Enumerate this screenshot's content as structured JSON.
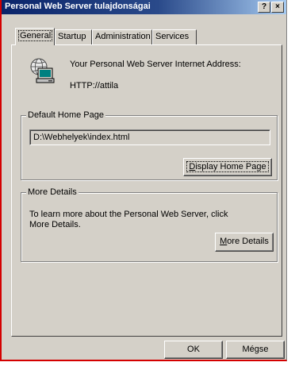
{
  "window": {
    "title": "Personal Web Server tulajdonságai",
    "help_glyph": "?",
    "close_glyph": "×"
  },
  "tabs": [
    {
      "label": "General",
      "active": true
    },
    {
      "label": "Startup",
      "active": false
    },
    {
      "label": "Administration",
      "active": false
    },
    {
      "label": "Services",
      "active": false
    }
  ],
  "general": {
    "server_icon": "pws-server-icon",
    "address_label": "Your Personal Web Server Internet Address:",
    "address_value": "HTTP://attila",
    "home_page_group": {
      "legend": "Default Home Page",
      "path": "D:\\Webhelyek\\index.html",
      "display_button": {
        "pre": "",
        "accel": "D",
        "post": "isplay Home Page"
      }
    },
    "more_details_group": {
      "legend": "More Details",
      "text_line1": "To learn more about the Personal Web Server, click",
      "text_line2": "More Details.",
      "more_button": {
        "pre": "",
        "accel": "M",
        "post": "ore Details"
      }
    }
  },
  "footer": {
    "ok_label": "OK",
    "cancel_label": "Mégse"
  }
}
